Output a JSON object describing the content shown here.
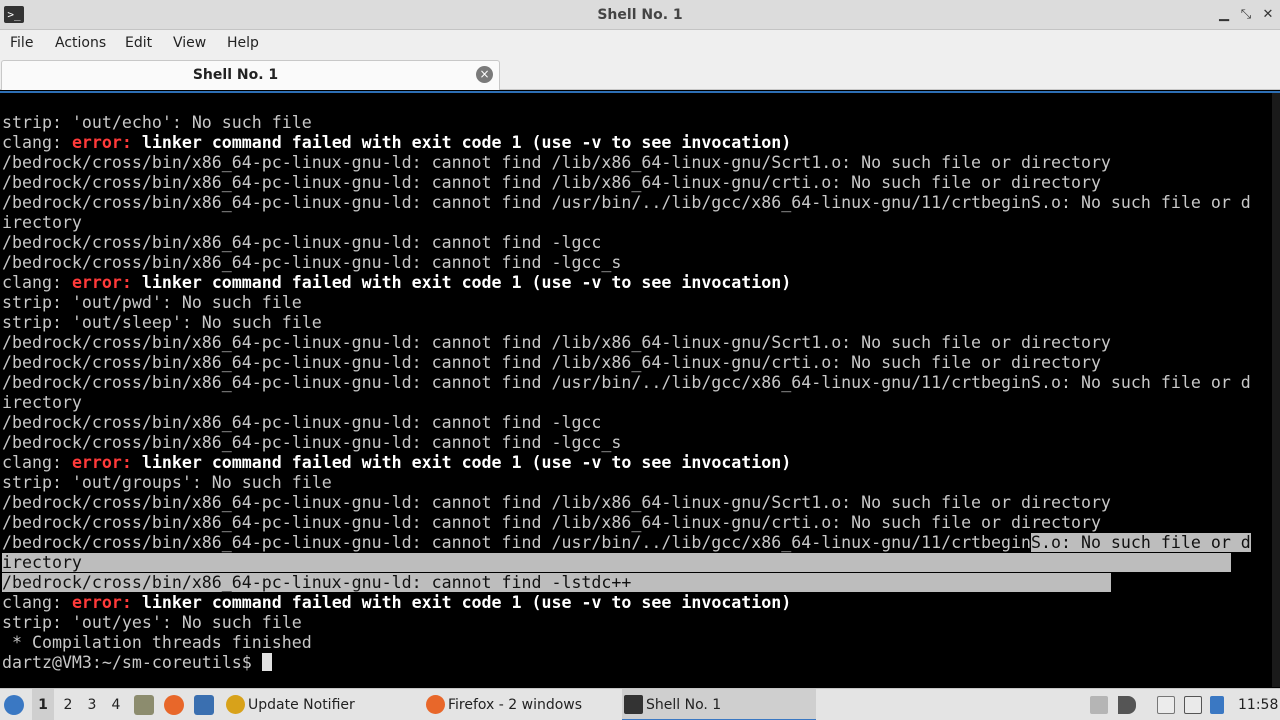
{
  "window": {
    "title": "Shell No. 1",
    "app_icon": "terminal-icon",
    "buttons": {
      "minimize": "▁",
      "maximize": "⤡",
      "close": "✕"
    }
  },
  "menu": [
    "File",
    "Actions",
    "Edit",
    "View",
    "Help"
  ],
  "tab": {
    "label": "Shell No. 1",
    "close_icon": "×"
  },
  "terminal": {
    "lines": [
      [
        {
          "t": "strip: 'out/echo': No such file",
          "s": ""
        }
      ],
      [
        {
          "t": "clang: ",
          "s": ""
        },
        {
          "t": "error:",
          "s": "err"
        },
        {
          "t": " linker command failed with exit code 1 (use -v to see invocation)",
          "s": "bold"
        }
      ],
      [
        {
          "t": "/bedrock/cross/bin/x86_64-pc-linux-gnu-ld: cannot find /lib/x86_64-linux-gnu/Scrt1.o: No such file or directory",
          "s": ""
        }
      ],
      [
        {
          "t": "/bedrock/cross/bin/x86_64-pc-linux-gnu-ld: cannot find /lib/x86_64-linux-gnu/crti.o: No such file or directory",
          "s": ""
        }
      ],
      [
        {
          "t": "/bedrock/cross/bin/x86_64-pc-linux-gnu-ld: cannot find /usr/bin/../lib/gcc/x86_64-linux-gnu/11/crtbeginS.o: No such file or d",
          "s": ""
        }
      ],
      [
        {
          "t": "irectory",
          "s": ""
        }
      ],
      [
        {
          "t": "/bedrock/cross/bin/x86_64-pc-linux-gnu-ld: cannot find -lgcc",
          "s": ""
        }
      ],
      [
        {
          "t": "/bedrock/cross/bin/x86_64-pc-linux-gnu-ld: cannot find -lgcc_s",
          "s": ""
        }
      ],
      [
        {
          "t": "clang: ",
          "s": ""
        },
        {
          "t": "error:",
          "s": "err"
        },
        {
          "t": " linker command failed with exit code 1 (use -v to see invocation)",
          "s": "bold"
        }
      ],
      [
        {
          "t": "strip: 'out/pwd': No such file",
          "s": ""
        }
      ],
      [
        {
          "t": "strip: 'out/sleep': No such file",
          "s": ""
        }
      ],
      [
        {
          "t": "/bedrock/cross/bin/x86_64-pc-linux-gnu-ld: cannot find /lib/x86_64-linux-gnu/Scrt1.o: No such file or directory",
          "s": ""
        }
      ],
      [
        {
          "t": "/bedrock/cross/bin/x86_64-pc-linux-gnu-ld: cannot find /lib/x86_64-linux-gnu/crti.o: No such file or directory",
          "s": ""
        }
      ],
      [
        {
          "t": "/bedrock/cross/bin/x86_64-pc-linux-gnu-ld: cannot find /usr/bin/../lib/gcc/x86_64-linux-gnu/11/crtbeginS.o: No such file or d",
          "s": ""
        }
      ],
      [
        {
          "t": "irectory",
          "s": ""
        }
      ],
      [
        {
          "t": "/bedrock/cross/bin/x86_64-pc-linux-gnu-ld: cannot find -lgcc",
          "s": ""
        }
      ],
      [
        {
          "t": "/bedrock/cross/bin/x86_64-pc-linux-gnu-ld: cannot find -lgcc_s",
          "s": ""
        }
      ],
      [
        {
          "t": "clang: ",
          "s": ""
        },
        {
          "t": "error:",
          "s": "err"
        },
        {
          "t": " linker command failed with exit code 1 (use -v to see invocation)",
          "s": "bold"
        }
      ],
      [
        {
          "t": "strip: 'out/groups': No such file",
          "s": ""
        }
      ],
      [
        {
          "t": "/bedrock/cross/bin/x86_64-pc-linux-gnu-ld: cannot find /lib/x86_64-linux-gnu/Scrt1.o: No such file or directory",
          "s": ""
        }
      ],
      [
        {
          "t": "/bedrock/cross/bin/x86_64-pc-linux-gnu-ld: cannot find /lib/x86_64-linux-gnu/crti.o: No such file or directory",
          "s": ""
        }
      ],
      [
        {
          "t": "/bedrock/cross/bin/x86_64-pc-linux-gnu-ld: cannot find /usr/bin/../lib/gcc/x86_64-linux-gnu/11/crtbegin",
          "s": ""
        },
        {
          "t": "S.o: No such file or d",
          "s": "sel"
        }
      ],
      [
        {
          "t": "irectory                                                                                                                   ",
          "s": "sel"
        }
      ],
      [
        {
          "t": "/bedrock/cross/bin/x86_64-pc-linux-gnu-ld: cannot find -lstdc++                                                ",
          "s": "sel"
        }
      ],
      [
        {
          "t": "clang: ",
          "s": ""
        },
        {
          "t": "error:",
          "s": "err"
        },
        {
          "t": " linker command failed with exit code 1 (use -v to see invocation)",
          "s": "bold"
        }
      ],
      [
        {
          "t": "strip: 'out/yes': No such file",
          "s": ""
        }
      ],
      [
        {
          "t": " * Compilation threads finished",
          "s": ""
        }
      ]
    ],
    "prompt": "dartz@VM3:~/sm-coreutils$ "
  },
  "taskbar": {
    "start_icon": "start-menu-icon",
    "workspaces": [
      "1",
      "2",
      "3",
      "4"
    ],
    "active_workspace": "1",
    "quicklaunch": [
      "file-manager-icon",
      "firefox-icon",
      "desktop-icon"
    ],
    "tasks": [
      {
        "label": "Update Notifier",
        "icon": "update-notifier-icon"
      },
      {
        "label": "Firefox - 2 windows",
        "icon": "firefox-icon"
      },
      {
        "label": "Shell No. 1",
        "icon": "terminal-icon"
      }
    ],
    "tray": [
      "removable-media-icon",
      "volume-icon",
      "clipboard-icon",
      "network-icon",
      "bluetooth-icon"
    ],
    "clock": "11:58"
  },
  "colors": {
    "error": "#ff3a3a",
    "selection": "#bdbdbd",
    "accent": "#2d6fb5"
  }
}
